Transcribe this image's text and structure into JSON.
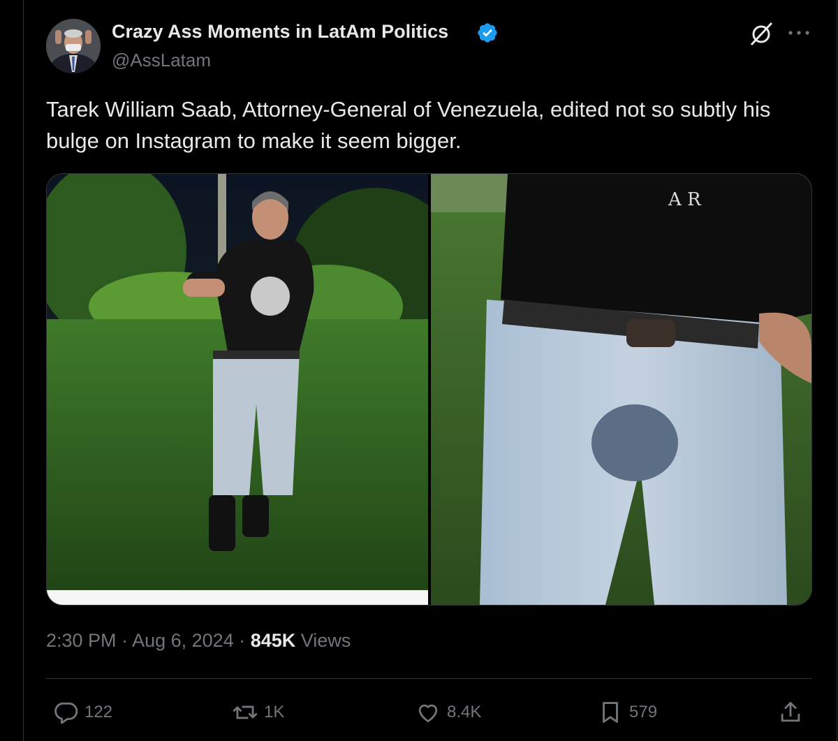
{
  "author": {
    "name": "Crazy Ass Moments in LatAm Politics",
    "handle": "@AssLatam"
  },
  "tweet": {
    "text": "Tarek William Saab, Attorney-General of Venezuela, edited not so subtly his bulge on Instagram to make it seem bigger."
  },
  "meta": {
    "time": "2:30 PM",
    "date": "Aug 6, 2024",
    "views_count": "845K",
    "views_label": "Views",
    "separator": " · "
  },
  "actions": {
    "replies": "122",
    "reposts": "1K",
    "likes": "8.4K",
    "bookmarks": "579"
  },
  "icons": [
    "verified-badge-icon",
    "grok-icon",
    "more-icon",
    "reply-icon",
    "repost-icon",
    "like-icon",
    "bookmark-icon",
    "share-icon"
  ],
  "colors": {
    "background": "#000000",
    "text": "#e7e9ea",
    "muted": "#71767b",
    "verified": "#1d9bf0"
  }
}
